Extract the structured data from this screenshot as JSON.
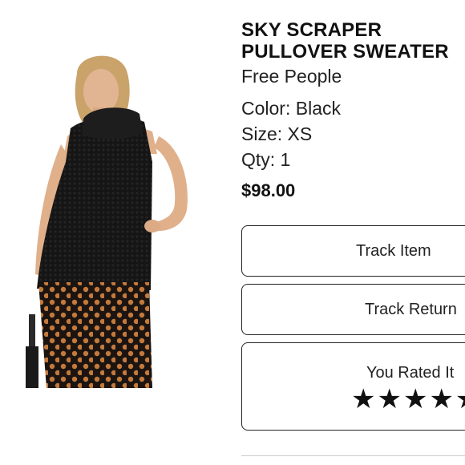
{
  "product": {
    "title": "SKY SCRAPER\nPULLOVER SWEATER",
    "brand": "Free People",
    "color": "Color: Black",
    "size": "Size: XS",
    "qty": "Qty: 1",
    "price": "$98.00"
  },
  "actions": {
    "track_item": "Track Item",
    "track_return": "Track Return",
    "rated_label": "You Rated It",
    "stars": "★★★★★",
    "rating": 5
  },
  "icons": {
    "star": "star-icon"
  }
}
